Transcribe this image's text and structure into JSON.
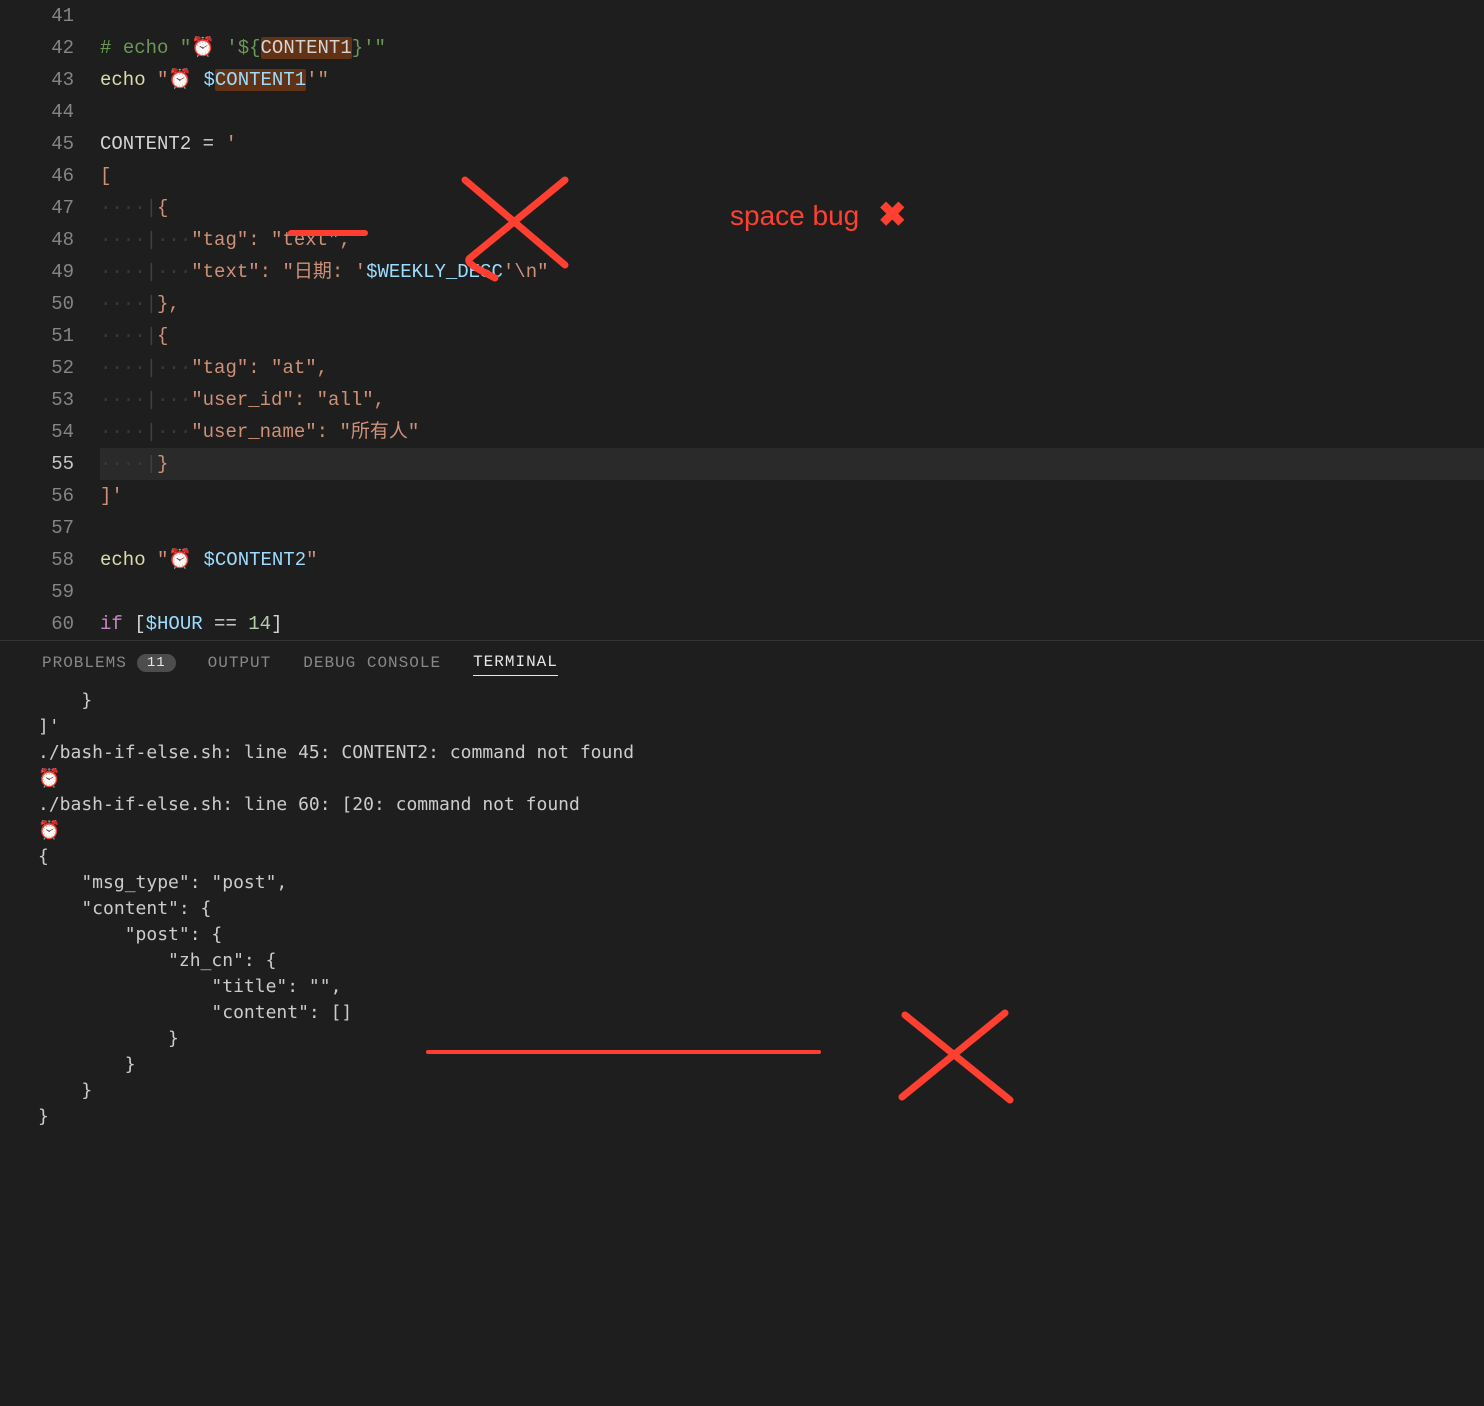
{
  "editor": {
    "lines": [
      {
        "n": 41,
        "tokens": []
      },
      {
        "n": 42,
        "tokens": [
          {
            "cls": "tok-cmt",
            "t": "# "
          },
          {
            "cls": "tok-cmt",
            "t": "echo "
          },
          {
            "cls": "tok-cmt",
            "t": "\"⏰ '"
          },
          {
            "cls": "tok-cmt",
            "t": "${"
          },
          {
            "cls": "hl-box",
            "t": "CONTENT1"
          },
          {
            "cls": "tok-cmt",
            "t": "}'\""
          }
        ]
      },
      {
        "n": 43,
        "tokens": [
          {
            "cls": "tok-cmd",
            "t": "echo "
          },
          {
            "cls": "tok-str",
            "t": "\"⏰ "
          },
          {
            "cls": "tok-var",
            "t": "$"
          },
          {
            "cls": "hl-box2",
            "t": "CONTENT1"
          },
          {
            "cls": "tok-str",
            "t": "'\""
          }
        ]
      },
      {
        "n": 44,
        "tokens": []
      },
      {
        "n": 45,
        "tokens": [
          {
            "cls": "tok-plain",
            "t": "CONTENT2 "
          },
          {
            "cls": "tok-op",
            "t": "= "
          },
          {
            "cls": "tok-str",
            "t": "'"
          }
        ]
      },
      {
        "n": 46,
        "tokens": [
          {
            "cls": "tok-str",
            "t": "["
          }
        ]
      },
      {
        "n": 47,
        "tokens": [
          {
            "cls": "dots",
            "t": "····"
          },
          {
            "cls": "guide",
            "t": "|"
          },
          {
            "cls": "tok-str",
            "t": "{"
          }
        ]
      },
      {
        "n": 48,
        "tokens": [
          {
            "cls": "dots",
            "t": "····"
          },
          {
            "cls": "guide",
            "t": "|"
          },
          {
            "cls": "dots",
            "t": "···"
          },
          {
            "cls": "tok-str",
            "t": "\"tag\": \"text\","
          }
        ]
      },
      {
        "n": 49,
        "tokens": [
          {
            "cls": "dots",
            "t": "····"
          },
          {
            "cls": "guide",
            "t": "|"
          },
          {
            "cls": "dots",
            "t": "···"
          },
          {
            "cls": "tok-str",
            "t": "\"text\": \"日期: '"
          },
          {
            "cls": "tok-var",
            "t": "$WEEKLY_DESC"
          },
          {
            "cls": "tok-str",
            "t": "'\\n\""
          }
        ]
      },
      {
        "n": 50,
        "tokens": [
          {
            "cls": "dots",
            "t": "····"
          },
          {
            "cls": "guide",
            "t": "|"
          },
          {
            "cls": "tok-str",
            "t": "},"
          }
        ]
      },
      {
        "n": 51,
        "tokens": [
          {
            "cls": "dots",
            "t": "····"
          },
          {
            "cls": "guide",
            "t": "|"
          },
          {
            "cls": "tok-str",
            "t": "{"
          }
        ]
      },
      {
        "n": 52,
        "tokens": [
          {
            "cls": "dots",
            "t": "····"
          },
          {
            "cls": "guide",
            "t": "|"
          },
          {
            "cls": "dots",
            "t": "···"
          },
          {
            "cls": "tok-str",
            "t": "\"tag\": \"at\","
          }
        ]
      },
      {
        "n": 53,
        "tokens": [
          {
            "cls": "dots",
            "t": "····"
          },
          {
            "cls": "guide",
            "t": "|"
          },
          {
            "cls": "dots",
            "t": "···"
          },
          {
            "cls": "tok-str",
            "t": "\"user_id\": \"all\","
          }
        ]
      },
      {
        "n": 54,
        "tokens": [
          {
            "cls": "dots",
            "t": "····"
          },
          {
            "cls": "guide",
            "t": "|"
          },
          {
            "cls": "dots",
            "t": "···"
          },
          {
            "cls": "tok-str",
            "t": "\"user_name\": \"所有人\""
          }
        ]
      },
      {
        "n": 55,
        "hl": true,
        "tokens": [
          {
            "cls": "dots",
            "t": "····"
          },
          {
            "cls": "guide",
            "t": "|"
          },
          {
            "cls": "tok-str",
            "t": "}"
          }
        ]
      },
      {
        "n": 56,
        "tokens": [
          {
            "cls": "tok-str",
            "t": "]'"
          }
        ]
      },
      {
        "n": 57,
        "tokens": []
      },
      {
        "n": 58,
        "tokens": [
          {
            "cls": "tok-cmd",
            "t": "echo "
          },
          {
            "cls": "tok-str",
            "t": "\"⏰ "
          },
          {
            "cls": "tok-var",
            "t": "$CONTENT2"
          },
          {
            "cls": "tok-str",
            "t": "\""
          }
        ]
      },
      {
        "n": 59,
        "tokens": []
      },
      {
        "n": 60,
        "tokens": [
          {
            "cls": "tok-key",
            "t": "if "
          },
          {
            "cls": "tok-brace",
            "t": "["
          },
          {
            "cls": "tok-var",
            "t": "$HOUR"
          },
          {
            "cls": "tok-op",
            "t": " == "
          },
          {
            "cls": "tok-num",
            "t": "14"
          },
          {
            "cls": "tok-brace",
            "t": "]"
          }
        ]
      }
    ]
  },
  "panel": {
    "tabs": {
      "problems": "PROBLEMS",
      "problems_count": "11",
      "output": "OUTPUT",
      "debug": "DEBUG CONSOLE",
      "terminal": "TERMINAL"
    },
    "terminal_text": "    }\n]'\n./bash-if-else.sh: line 45: CONTENT2: command not found\n⏰\n./bash-if-else.sh: line 60: [20: command not found\n⏰\n{\n    \"msg_type\": \"post\",\n    \"content\": {\n        \"post\": {\n            \"zh_cn\": {\n                \"title\": \"\",\n                \"content\": []\n            }\n        }\n    }\n}"
  },
  "annotations": {
    "space_bug_label": "space bug",
    "color": "#ff4030"
  }
}
